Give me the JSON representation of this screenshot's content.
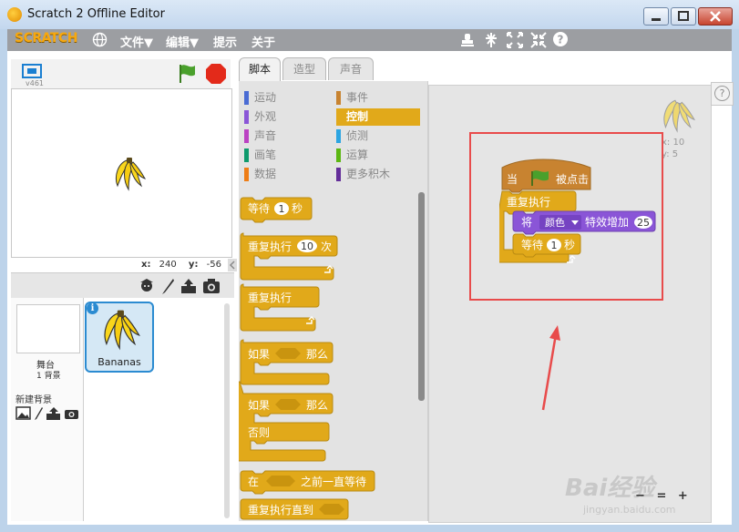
{
  "window": {
    "title": "Scratch 2 Offline Editor"
  },
  "menubar": {
    "logo": "SCRATCH",
    "items": [
      "文件▼",
      "编辑▼",
      "提示",
      "关于"
    ]
  },
  "stage": {
    "version": "v461",
    "coords_x_label": "x:",
    "coords_x": "240",
    "coords_y_label": "y:",
    "coords_y": "-56"
  },
  "sprites": {
    "stage_label": "舞台",
    "stage_bg_count": "1 背景",
    "new_backdrop": "新建背景",
    "sprite_name": "Bananas",
    "info": "i"
  },
  "tabs": [
    "脚本",
    "造型",
    "声音"
  ],
  "categories": {
    "left": [
      {
        "label": "运动",
        "color": "#4a6cd4"
      },
      {
        "label": "外观",
        "color": "#8a55d7"
      },
      {
        "label": "声音",
        "color": "#bb42c3"
      },
      {
        "label": "画笔",
        "color": "#0e9a6c"
      },
      {
        "label": "数据",
        "color": "#ee7d16"
      }
    ],
    "right": [
      {
        "label": "事件",
        "color": "#c88330"
      },
      {
        "label": "控制",
        "color": "#e1a91a"
      },
      {
        "label": "侦测",
        "color": "#2ca5e2"
      },
      {
        "label": "运算",
        "color": "#5cb712"
      },
      {
        "label": "更多积木",
        "color": "#632d99"
      }
    ]
  },
  "palette_blocks": {
    "wait": "等待",
    "wait_val": "1",
    "sec": "秒",
    "repeat": "重复执行",
    "repeat_val": "10",
    "times": "次",
    "forever": "重复执行",
    "if": "如果",
    "then": "那么",
    "if2": "如果",
    "then2": "那么",
    "else": "否则",
    "wait_until_a": "在",
    "wait_until_b": "之前一直等待",
    "repeat_until": "重复执行直到"
  },
  "script": {
    "hat_a": "当",
    "hat_b": "被点击",
    "forever": "重复执行",
    "change_a": "将",
    "effect": "颜色",
    "change_b": "特效增加",
    "change_val": "25",
    "wait": "等待",
    "wait_val": "1",
    "sec": "秒"
  },
  "sprite_info": {
    "x": "x: 10",
    "y": "y: 5"
  },
  "zoom": {
    "minus": "−",
    "reset": "=",
    "plus": "+"
  },
  "watermark": {
    "brand": "Bai经验",
    "url": "jingyan.baidu.com"
  },
  "colors": {
    "control": "#e1a91a",
    "events": "#c88330",
    "looks": "#8a55d7",
    "highlight": "#e84b4b"
  }
}
